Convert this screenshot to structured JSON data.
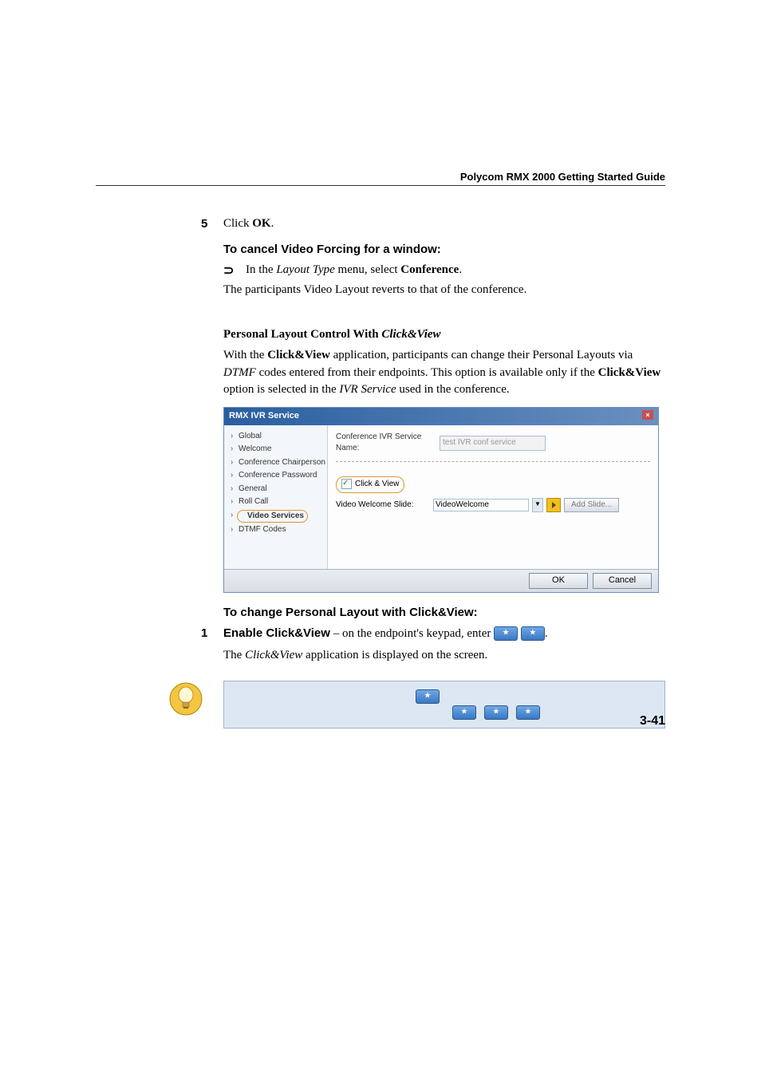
{
  "header": {
    "guide_title": "Polycom RMX 2000 Getting Started Guide"
  },
  "steps": {
    "five_num": "5",
    "five_prefix": "Click ",
    "five_bold": "OK",
    "five_suffix": "."
  },
  "cancel": {
    "heading": "To cancel Video Forcing for a window:",
    "bullet_prefix": "In the ",
    "bullet_italic": "Layout Type",
    "bullet_mid": " menu, select ",
    "bullet_bold": "Conference",
    "bullet_suffix": ".",
    "after": "The participants Video Layout reverts to that of the conference."
  },
  "personal": {
    "heading_prefix": "Personal Layout Control With ",
    "heading_italic": "Click&View",
    "p1_a": "With the ",
    "p1_b": "Click&View",
    "p1_c": " application, participants can change their Personal Layouts via ",
    "p1_d": "DTMF",
    "p1_e": " codes entered from their endpoints. This option is available only if the ",
    "p1_f": "Click&View",
    "p1_g": " option is selected in the ",
    "p1_h": "IVR Service",
    "p1_i": " used in the conference."
  },
  "dialog": {
    "title": "RMX IVR Service",
    "nav": {
      "global": "Global",
      "welcome": "Welcome",
      "conf_chair": "Conference Chairperson",
      "conf_pass": "Conference Password",
      "general": "General",
      "roll_call": "Roll Call",
      "video_services": "Video Services",
      "dtmf_codes": "DTMF Codes"
    },
    "fields": {
      "service_name_label": "Conference IVR Service Name:",
      "service_name_value": "test IVR conf service",
      "click_view_label": "Click & View",
      "welcome_slide_label": "Video Welcome Slide:",
      "welcome_slide_value": "VideoWelcome",
      "add_slide_btn": "Add Slide..."
    },
    "buttons": {
      "ok": "OK",
      "cancel": "Cancel"
    }
  },
  "change": {
    "heading": "To change Personal Layout with Click&View:",
    "one_num": "1",
    "one_bold": "Enable Click&View",
    "one_mid": " – on the endpoint's keypad, enter ",
    "one_suffix": ".",
    "after_a": "The ",
    "after_b": "Click&View",
    "after_c": " application is displayed on the screen."
  },
  "footer": {
    "page_num": "3-41"
  }
}
